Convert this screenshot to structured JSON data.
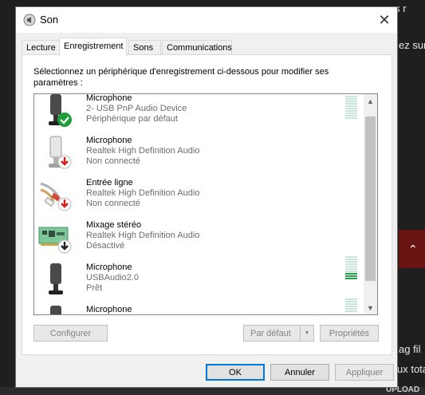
{
  "background": {
    "fragments": [
      "asser ces r",
      "ez sur",
      "ag fil",
      "ux tota",
      "UPLOAD"
    ]
  },
  "dialog": {
    "title": "Son",
    "close_glyph": "✕",
    "tabs": [
      {
        "label": "Lecture"
      },
      {
        "label": "Enregistrement",
        "active": true
      },
      {
        "label": "Sons"
      },
      {
        "label": "Communications"
      }
    ],
    "instructions": "Sélectionnez un périphérique d'enregistrement ci-dessous pour modifier ses paramètres :",
    "devices": [
      {
        "name": "Microphone",
        "description": "2- USB PnP Audio Device",
        "status": "Périphérique par défaut",
        "icon": "microphone-icon",
        "badge": "default-check-icon",
        "meter_level": 0
      },
      {
        "name": "Microphone",
        "description": "Realtek High Definition Audio",
        "status": "Non connecté",
        "icon": "microphone-icon",
        "badge": "disconnected-arrow-icon"
      },
      {
        "name": "Entrée ligne",
        "description": "Realtek High Definition Audio",
        "status": "Non connecté",
        "icon": "line-in-cable-icon",
        "badge": "disconnected-arrow-icon"
      },
      {
        "name": "Mixage stéréo",
        "description": "Realtek High Definition Audio",
        "status": "Désactivé",
        "icon": "sound-card-icon",
        "badge": "disabled-arrow-icon"
      },
      {
        "name": "Microphone",
        "description": "USBAudio2.0",
        "status": "Prêt",
        "icon": "microphone-icon",
        "badge": "",
        "meter_level": 0.3
      },
      {
        "name": "Microphone",
        "description": "",
        "status": "",
        "icon": "microphone-icon",
        "badge": "",
        "meter_level": 0
      }
    ],
    "buttons": {
      "configure": "Configurer",
      "set_default": "Par défaut",
      "properties": "Propriétés",
      "ok": "OK",
      "cancel": "Annuler",
      "apply": "Appliquer"
    },
    "colors": {
      "accent": "#0078d7",
      "check_green": "#1e9e3a",
      "disconnected_red": "#d81e1e",
      "meter_on": "#27a047",
      "meter_off": "#c8e6dc"
    }
  }
}
